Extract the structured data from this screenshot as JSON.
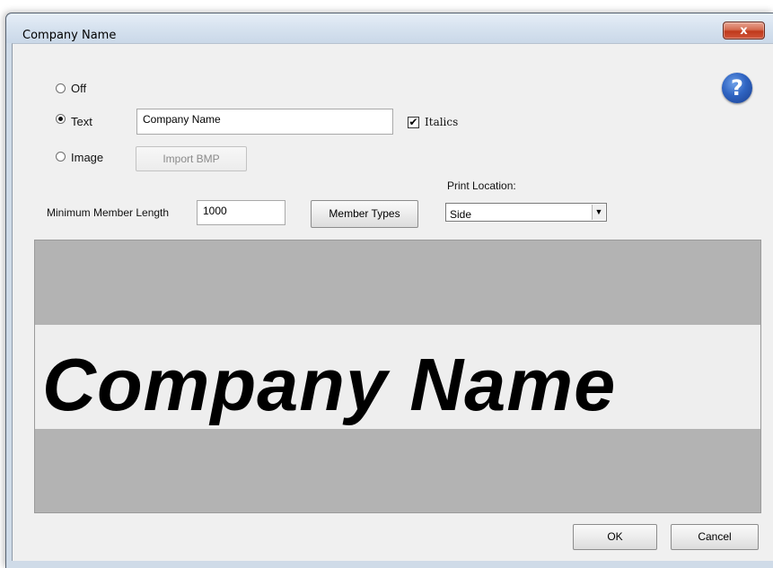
{
  "window": {
    "title": "Company Name",
    "close_label": "x"
  },
  "options": {
    "off_label": "Off",
    "text_label": "Text",
    "image_label": "Image",
    "selected": "Text"
  },
  "text_field": {
    "value": "Company Name"
  },
  "italics": {
    "label": "Italics",
    "checked": true,
    "mark": "✔"
  },
  "import_button": {
    "label": "Import BMP",
    "enabled": false
  },
  "min_length": {
    "label": "Minimum Member Length",
    "value": "1000"
  },
  "member_types_button": {
    "label": "Member Types"
  },
  "print_location": {
    "label": "Print Location:",
    "selected": "Side"
  },
  "help": {
    "glyph": "?"
  },
  "preview": {
    "text": "Company Name"
  },
  "buttons": {
    "ok": "OK",
    "cancel": "Cancel"
  },
  "colors": {
    "preview_background": "#b3b3b3",
    "preview_band": "#eeeeee",
    "help_icon": "#2f64c2",
    "close_button": "#c0391b"
  }
}
